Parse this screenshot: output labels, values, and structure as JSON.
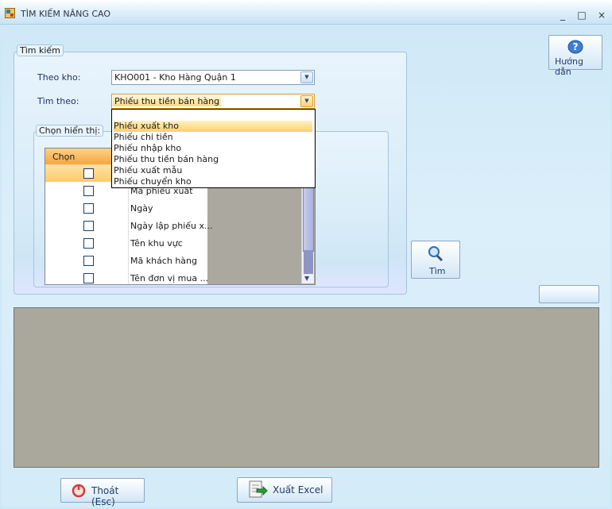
{
  "window": {
    "title": "TÌM KIẾM NÂNG CAO",
    "minimize": "_",
    "maximize": "□",
    "close": "×"
  },
  "search_group": {
    "label": "Tìm kiếm",
    "warehouse_label": "Theo kho:",
    "warehouse_value": "KHO001 - Kho Hàng Quận 1",
    "search_by_label": "Tìm theo:",
    "search_by_value": "Phiếu thu tiền bán hàng",
    "dropdown_options": [
      "Phiếu xuất kho",
      "Phiếu chi tiền",
      "Phiếu nhập kho",
      "Phiếu thu tiền bán hàng",
      "Phiếu xuất mẫu",
      "Phiếu chuyển kho"
    ],
    "dropdown_highlighted": "Phiếu xuất kho"
  },
  "display_group": {
    "label": "Chọn hiển thị:",
    "column_header": "Chọn",
    "rows": [
      {
        "label": "",
        "checked": false
      },
      {
        "label": "Mã phiếu xuất",
        "checked": false
      },
      {
        "label": "Ngày",
        "checked": false
      },
      {
        "label": "Ngày lập phiếu x...",
        "checked": false
      },
      {
        "label": "Tên khu vực",
        "checked": false
      },
      {
        "label": "Mã khách hàng",
        "checked": false
      },
      {
        "label": "Tên đơn vị mua ...",
        "checked": false
      }
    ]
  },
  "buttons": {
    "help": "Hướng dẫn",
    "search": "Tìm",
    "exit": "Thoát (Esc)",
    "export": "Xuất Excel"
  },
  "icons": {
    "help": "question-icon",
    "search": "magnifier-icon",
    "exit": "power-icon",
    "export": "excel-export-icon",
    "app": "app-window-icon"
  },
  "colors": {
    "background": "#cfe8f7",
    "grid_header": "#f6a43c",
    "results_panel": "#aaa89d",
    "button_text": "#1f3d6e"
  }
}
